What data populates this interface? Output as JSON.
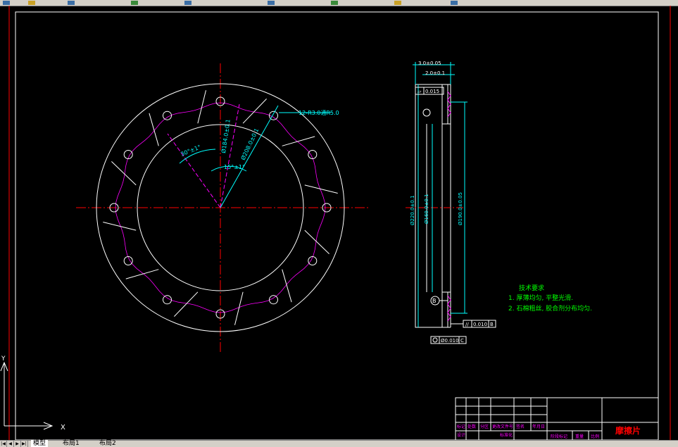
{
  "colors": {
    "background": "#000000",
    "outline": "#ffffff",
    "dimension": "#00ffff",
    "center_line": "#ff0000",
    "slot_line": "#ff00ff",
    "note_text": "#00ff00",
    "title_text": "#ff0000"
  },
  "tabs": {
    "model": "模型",
    "layout1": "布局1",
    "layout2": "布局2"
  },
  "front_view": {
    "dim_hole_callout": "12-R3.0通R5.0",
    "dim_angle_30": "30°±1°",
    "dim_angle_15": "15°±1°",
    "dim_dia_184": "Ø184.0±0.1",
    "dim_dia_208": "Ø208.0±0.1"
  },
  "side_view": {
    "dim_thickness_total": "3.0±0.05",
    "dim_thickness_layer": "2.0±0.1",
    "dim_dia_220": "Ø220.0±0.1",
    "dim_dia_160": "Ø160.0±0.1",
    "dim_dia_190": "Ø190.0±0.05",
    "flatness_tol": "0.015",
    "parallel_tol": "0.010",
    "parallel_datum": "B",
    "position_tol": "Ø0.010",
    "position_datum": "C",
    "datum_b": "B"
  },
  "tech_requirements": {
    "title": "技术要求",
    "item1": "1. 厚薄均匀, 平整光滑.",
    "item2": "2. 石棉粗丝, 胶合剂分布均匀."
  },
  "title_block": {
    "part_name": "摩擦片",
    "cell_biaoji": "标记",
    "cell_chushu": "处数",
    "cell_fenqu": "分区",
    "cell_gengai": "更改文件号",
    "cell_qianming": "签名",
    "cell_nianyueri": "年月日",
    "cell_sheji": "设计",
    "cell_biaozhunhua": "标准化",
    "cell_jieduan": "阶段标记",
    "cell_zhongliang": "重量",
    "cell_bili": "比例"
  },
  "ucs": {
    "x_label": "X",
    "y_label": "Y"
  }
}
